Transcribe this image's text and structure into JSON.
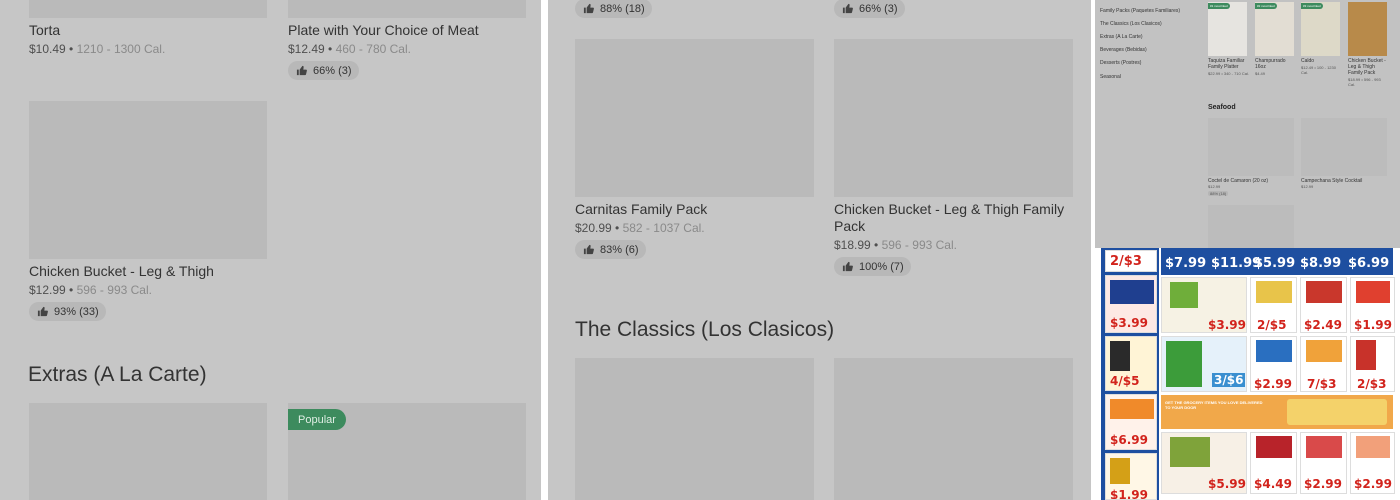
{
  "panel1": {
    "items": [
      {
        "name": "Torta",
        "price": "$10.49",
        "cal": "1210 - 1300 Cal."
      },
      {
        "name": "Plate with Your Choice of Meat",
        "price": "$12.49",
        "cal": "460 - 780 Cal.",
        "rating": "66% (3)"
      },
      {
        "name": "Chicken Bucket - Leg & Thigh",
        "price": "$12.99",
        "cal": "596 - 993 Cal.",
        "rating": "93% (33)"
      }
    ],
    "section_title": "Extras (A La Carte)",
    "badge": "Popular"
  },
  "panel2": {
    "top_ratings": [
      "88% (18)",
      "66% (3)"
    ],
    "items": [
      {
        "name": "Carnitas Family Pack",
        "price": "$20.99",
        "cal": "582 - 1037 Cal.",
        "rating": "83% (6)"
      },
      {
        "name": "Chicken Bucket - Leg & Thigh Family Pack",
        "price": "$18.99",
        "cal": "596 - 993 Cal.",
        "rating": "100% (7)"
      }
    ],
    "section_title": "The Classics (Los Clasicos)"
  },
  "panel3": {
    "sidebar": [
      "Family Packs (Paquetes Familiares)",
      "The Classics (Los Clasicos)",
      "Extras (A La Carte)",
      "Beverages (Bebidas)",
      "Desserts (Postres)",
      "Seasonal"
    ],
    "top_items": [
      {
        "name": "Taquiza Familiar Family Platter",
        "price": "$22.99 • 340 - 710 Cal."
      },
      {
        "name": "Champurrado 16oz",
        "price": "$4.49"
      },
      {
        "name": "Caldo",
        "price": "$12.49 • 100 - 1230 Cal."
      },
      {
        "name": "Chicken Bucket - Leg & Thigh Family Pack",
        "price": "$18.99 • 596 - 993 Cal."
      }
    ],
    "section_title": "Seafood",
    "seafood": [
      {
        "name": "Coctel de Camaron (20 oz)",
        "price": "$12.99",
        "rating": "88% (18)"
      },
      {
        "name": "Campechana Style Cocktail",
        "price": "$12.99"
      }
    ]
  },
  "panel4": {
    "top_prices": [
      "$7.99",
      "$11.99",
      "$5.99",
      "$8.99",
      "$6.99"
    ],
    "left_prices": [
      "2/$3",
      "$3.99",
      "4/$5",
      "$6.99",
      "$1.99"
    ],
    "grid_prices": [
      "$3.99",
      "2/$5",
      "$2.49",
      "$1.99",
      "3/$6",
      "$2.99",
      "7/$3",
      "2/$3",
      "$5.99",
      "$4.49",
      "$2.99",
      "$2.99"
    ],
    "banner": "GET THE GROCERY ITEMS YOU LOVE DELIVERED TO YOUR DOOR"
  },
  "colors": {
    "badge": "#3d8b5e",
    "flyer_blue": "#1e4fa0",
    "flyer_red": "#d2231c"
  }
}
